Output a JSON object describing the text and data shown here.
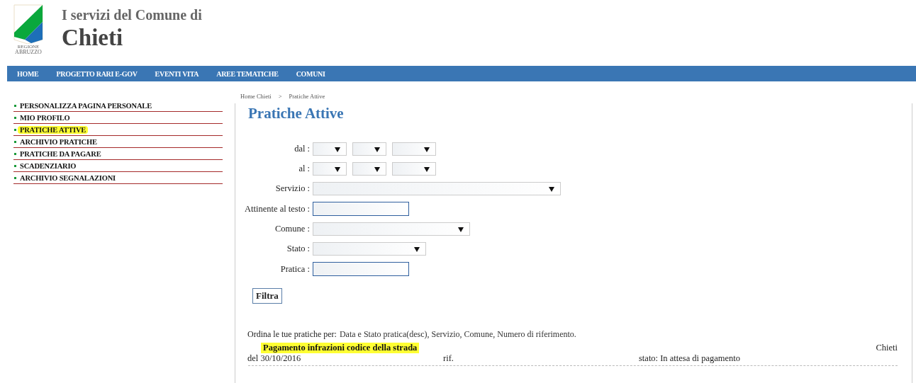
{
  "header": {
    "logo_text": [
      "REGIONE",
      "ABRUZZO"
    ],
    "subtitle": "I servizi del Comune di",
    "title": "Chieti"
  },
  "nav": [
    "HOME",
    "PROGETTO RARI E-GOV",
    "EVENTI VITA",
    "AREE TEMATICHE",
    "COMUNI"
  ],
  "sidebar": {
    "items": [
      {
        "label": "PERSONALIZZA PAGINA PERSONALE",
        "selected": false
      },
      {
        "label": "MIO PROFILO",
        "selected": false
      },
      {
        "label": "PRATICHE ATTIVE",
        "selected": true
      },
      {
        "label": "ARCHIVIO PRATICHE",
        "selected": false
      },
      {
        "label": "PRATICHE DA PAGARE",
        "selected": false
      },
      {
        "label": "SCADENZIARIO",
        "selected": false
      },
      {
        "label": "ARCHIVIO SEGNALAZIONI",
        "selected": false
      }
    ]
  },
  "breadcrumb": [
    "Home Chieti",
    ">",
    "Pratiche Attive"
  ],
  "page_title": "Pratiche Attive",
  "filters": [
    {
      "label": "dal :",
      "kind": "date"
    },
    {
      "label": "al :",
      "kind": "date"
    },
    {
      "label": "Servizio :",
      "kind": "select"
    },
    {
      "label": "Attinente al testo :",
      "kind": "text"
    },
    {
      "label": "Comune :",
      "kind": "select"
    },
    {
      "label": "Stato :",
      "kind": "select"
    },
    {
      "label": "Pratica :",
      "kind": "text"
    }
  ],
  "filter_button": "Filtra",
  "sort": {
    "label": "Ordina le tue pratiche per:",
    "options": "Data e Stato pratica(desc), Servizio, Comune, Numero di riferimento."
  },
  "results": [
    {
      "title": "Pagamento infrazioni codice della strada",
      "highlighted": true,
      "comune": "Chieti",
      "date": "del 30/10/2016",
      "ref": "rif.",
      "status": "stato: In attesa di pagamento"
    }
  ]
}
